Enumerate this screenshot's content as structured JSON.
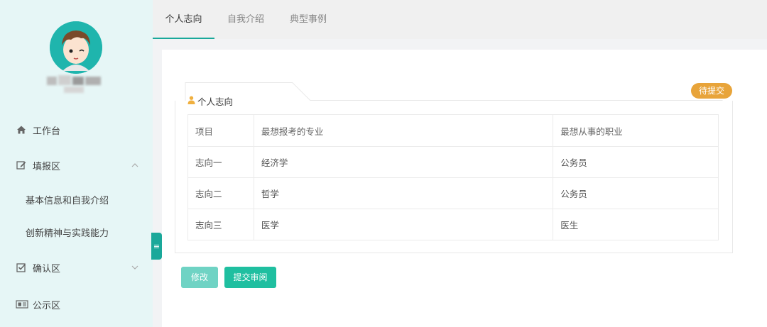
{
  "sidebar": {
    "username": "",
    "items": [
      {
        "label": "工作台",
        "icon": "home-icon"
      },
      {
        "label": "填报区",
        "icon": "edit-icon",
        "chevron": "up"
      },
      {
        "label": "基本信息和自我介绍"
      },
      {
        "label": "创新精神与实践能力"
      },
      {
        "label": "确认区",
        "icon": "checkbox-icon",
        "chevron": "down"
      },
      {
        "label": "公示区",
        "icon": "newspaper-icon"
      }
    ]
  },
  "tabs": [
    {
      "label": "个人志向",
      "active": true
    },
    {
      "label": "自我介绍",
      "active": false
    },
    {
      "label": "典型事例",
      "active": false
    }
  ],
  "card": {
    "title": "个人志向",
    "status_badge": "待提交",
    "table": {
      "headers": [
        "项目",
        "最想报考的专业",
        "最想从事的职业"
      ],
      "rows": [
        [
          "志向一",
          "经济学",
          "公务员"
        ],
        [
          "志向二",
          "哲学",
          "公务员"
        ],
        [
          "志向三",
          "医学",
          "医生"
        ]
      ]
    }
  },
  "buttons": {
    "edit": "修改",
    "submit": "提交审阅"
  },
  "colors": {
    "accent": "#1aa89a",
    "sidebar_bg": "#e6f6f6",
    "badge": "#e8a43a",
    "edit_button": "#6fd3c4",
    "submit_button": "#1fbfa0"
  }
}
